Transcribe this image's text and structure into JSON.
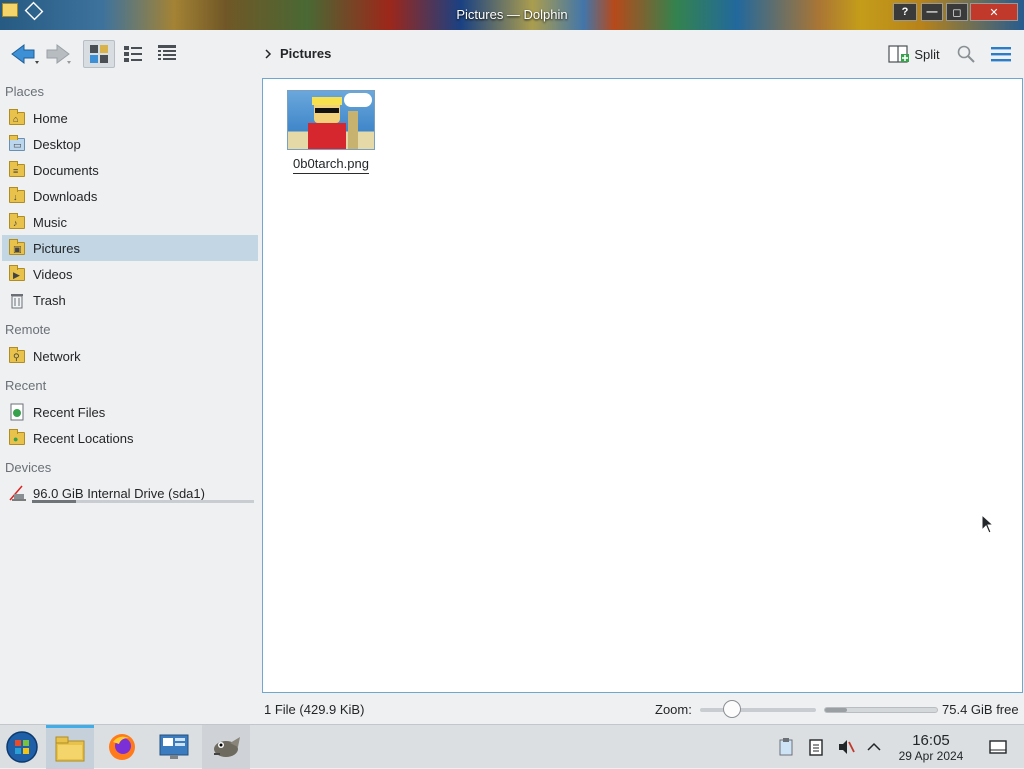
{
  "window": {
    "title": "Pictures — Dolphin"
  },
  "titlebar_buttons": {
    "help": "?",
    "minimize": "—",
    "maximize": "◻",
    "close": "✕"
  },
  "toolbar": {
    "breadcrumb": "Pictures",
    "split_label": "Split"
  },
  "sidebar": {
    "sections": {
      "places": "Places",
      "remote": "Remote",
      "recent": "Recent",
      "devices": "Devices"
    },
    "places": [
      {
        "label": "Home",
        "icon": "home-folder-icon"
      },
      {
        "label": "Desktop",
        "icon": "desktop-folder-icon"
      },
      {
        "label": "Documents",
        "icon": "documents-folder-icon"
      },
      {
        "label": "Downloads",
        "icon": "downloads-folder-icon"
      },
      {
        "label": "Music",
        "icon": "music-folder-icon"
      },
      {
        "label": "Pictures",
        "icon": "pictures-folder-icon",
        "active": true
      },
      {
        "label": "Videos",
        "icon": "videos-folder-icon"
      },
      {
        "label": "Trash",
        "icon": "trash-icon"
      }
    ],
    "remote": [
      {
        "label": "Network",
        "icon": "network-folder-icon"
      }
    ],
    "recent": [
      {
        "label": "Recent Files",
        "icon": "recent-files-icon"
      },
      {
        "label": "Recent Locations",
        "icon": "recent-locations-icon"
      }
    ],
    "devices": [
      {
        "label": "96.0 GiB Internal Drive (sda1)",
        "icon": "drive-icon",
        "usage_fraction": 0.2
      }
    ]
  },
  "files": [
    {
      "name": "0b0tarch.png"
    }
  ],
  "statusbar": {
    "summary": "1 File (429.9 KiB)",
    "zoom_label": "Zoom:",
    "zoom_fraction": 0.2,
    "free_space": "75.4 GiB free",
    "used_fraction": 0.2
  },
  "taskbar": {
    "apps": [
      "start-menu-icon",
      "dolphin-icon",
      "firefox-icon",
      "system-monitor-icon",
      "gimp-icon"
    ],
    "clock_time": "16:05",
    "clock_date": "29 Apr 2024"
  },
  "colors": {
    "accent": "#3daee9",
    "selection": "#c2d6e4",
    "folder": "#e8c24a",
    "view_border": "#6fa7cf"
  }
}
